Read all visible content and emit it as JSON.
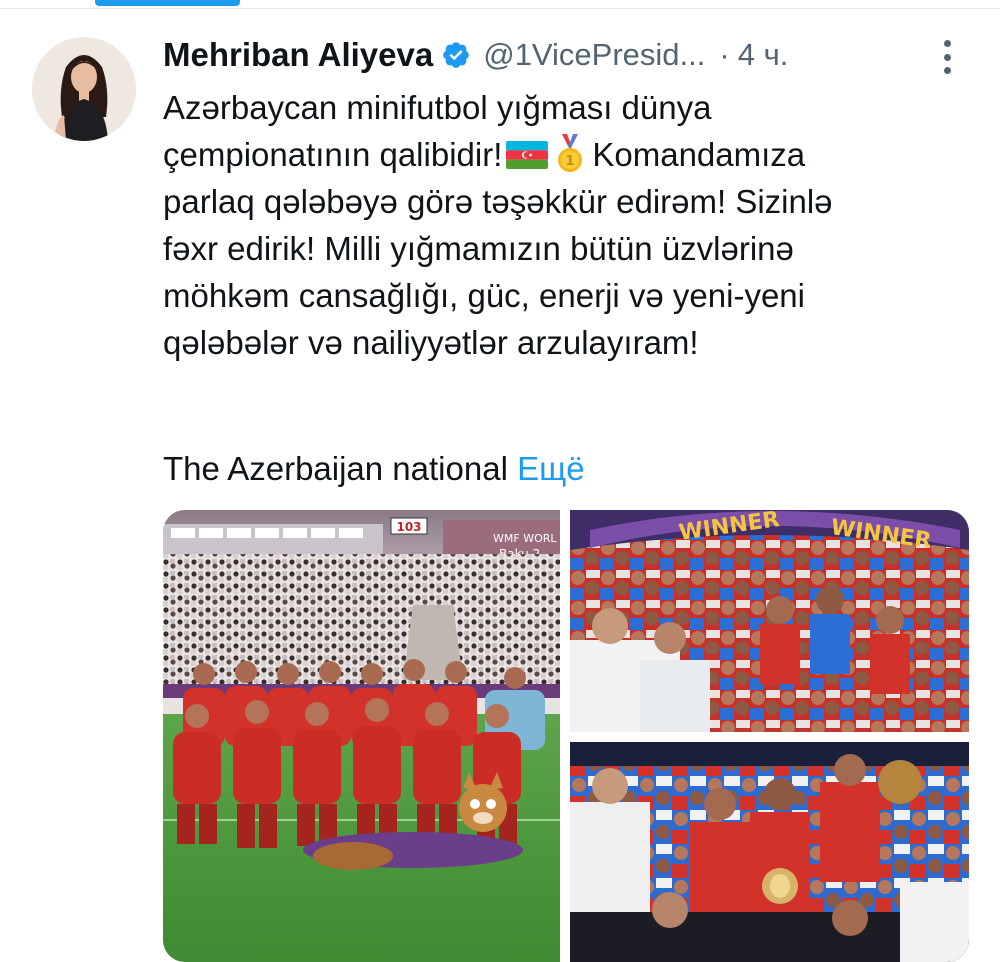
{
  "tweet": {
    "author_name": "Mehriban Aliyeva",
    "handle": "@1VicePresid...",
    "separator": "·",
    "time": "4 ч.",
    "text_lines": [
      "Azərbaycan minifutbol yığması dünya",
      "çempionatının qalibidir!",
      "Komandamıza",
      "parlaq qələbəyə görə təşəkkür edirəm! Sizinlə",
      "fəxr edirik! Milli yığmamızın bütün üzvlərinə",
      "möhkəm cansağlığı, güc, enerji və yeni-yeni",
      "qələbələr və nailiyyətlər arzulayıram!"
    ],
    "translation_preview": "The Azerbaijan national",
    "show_more": "Ещё",
    "emojis": [
      "azerbaijan-flag",
      "gold-medal"
    ]
  },
  "media": {
    "photo1": {
      "scoreboard_number": "103",
      "banner_text": "WMF WORL",
      "banner_text2": "Baku 2"
    },
    "photo2": {
      "banner_text": "WINNER",
      "banner_text2": "WINNER"
    }
  },
  "colors": {
    "accent": "#1d9bf0",
    "text": "#0f1419",
    "secondary": "#536471",
    "jersey_red": "#d3322a"
  },
  "icons": {
    "verified": "verified-badge-icon",
    "more": "more-options-icon"
  }
}
